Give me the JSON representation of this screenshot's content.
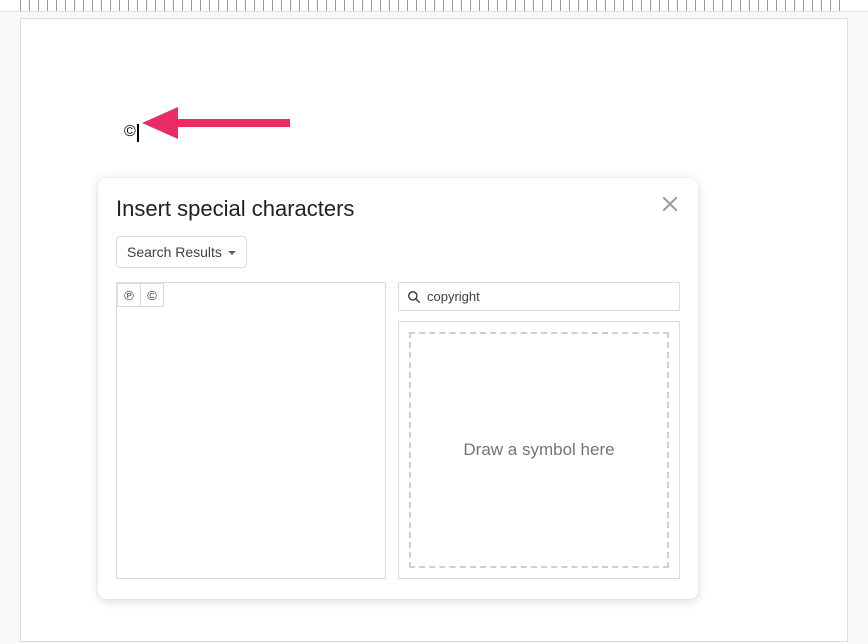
{
  "doc": {
    "inserted_char": "©"
  },
  "dialog": {
    "title": "Insert special characters",
    "category_label": "Search Results",
    "search_value": "copyright",
    "draw_placeholder": "Draw a symbol here",
    "results": {
      "char1": "℗",
      "char2": "©"
    }
  },
  "arrow": {
    "color": "#eb2b66"
  }
}
